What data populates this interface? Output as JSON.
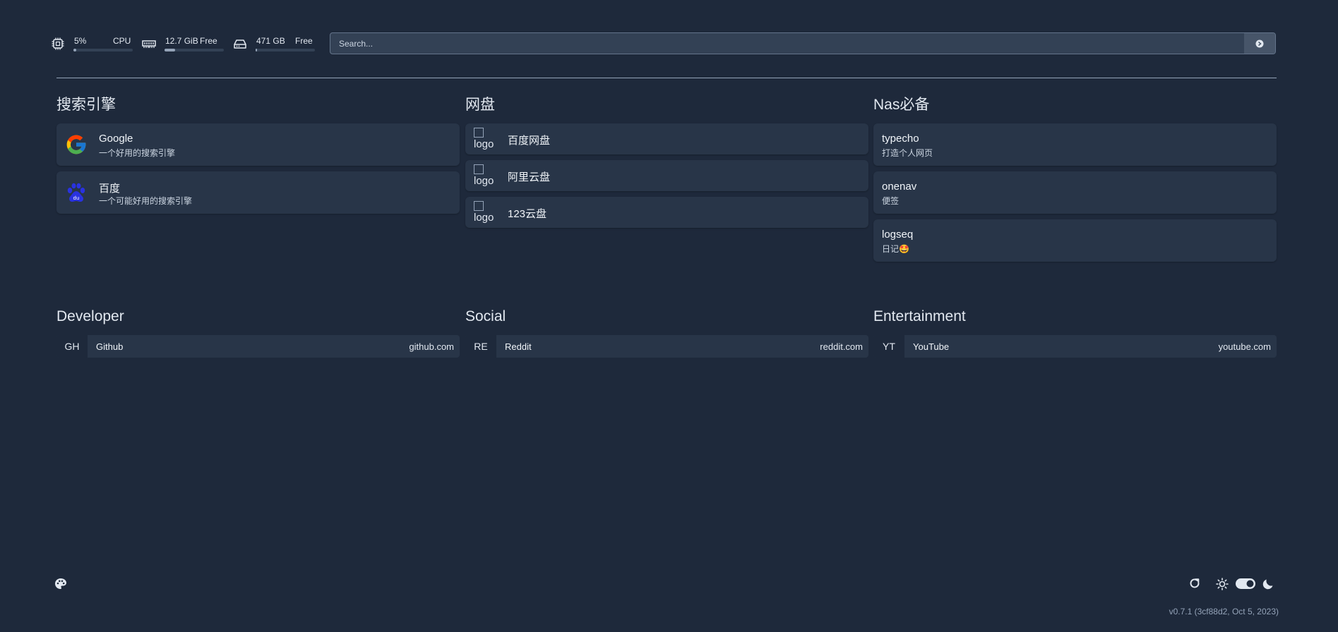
{
  "widgets": {
    "cpu": {
      "value": "5%",
      "label": "CPU",
      "percent": 5
    },
    "memory": {
      "value": "12.7 GiB",
      "label": "Free",
      "percent": 18
    },
    "disk": {
      "value": "471 GB",
      "label": "Free",
      "percent": 2
    }
  },
  "search": {
    "placeholder": "Search...",
    "value": ""
  },
  "services": [
    {
      "title": "搜索引擎",
      "items": [
        {
          "name": "Google",
          "description": "一个好用的搜索引擎",
          "icon": "google-logo"
        },
        {
          "name": "百度",
          "description": "一个可能好用的搜索引擎",
          "icon": "baidu-logo"
        }
      ]
    },
    {
      "title": "网盘",
      "items": [
        {
          "name": "百度网盘",
          "logo_alt": "logo"
        },
        {
          "name": "阿里云盘",
          "logo_alt": "logo"
        },
        {
          "name": "123云盘",
          "logo_alt": "logo"
        }
      ]
    },
    {
      "title": "Nas必备",
      "items": [
        {
          "name": "typecho",
          "description": "打造个人网页"
        },
        {
          "name": "onenav",
          "description": "便签"
        },
        {
          "name": "logseq",
          "description": "日记🤩"
        }
      ]
    }
  ],
  "bookmarks": [
    {
      "title": "Developer",
      "items": [
        {
          "abbr": "GH",
          "name": "Github",
          "url": "github.com"
        }
      ]
    },
    {
      "title": "Social",
      "items": [
        {
          "abbr": "RE",
          "name": "Reddit",
          "url": "reddit.com"
        }
      ]
    },
    {
      "title": "Entertainment",
      "items": [
        {
          "abbr": "YT",
          "name": "YouTube",
          "url": "youtube.com"
        }
      ]
    }
  ],
  "footer": {
    "version": "v0.7.1 (3cf88d2, Oct 5, 2023)"
  },
  "colors": {
    "background": "#1e293b",
    "card": "#283548",
    "accent": "#94a3b8"
  }
}
